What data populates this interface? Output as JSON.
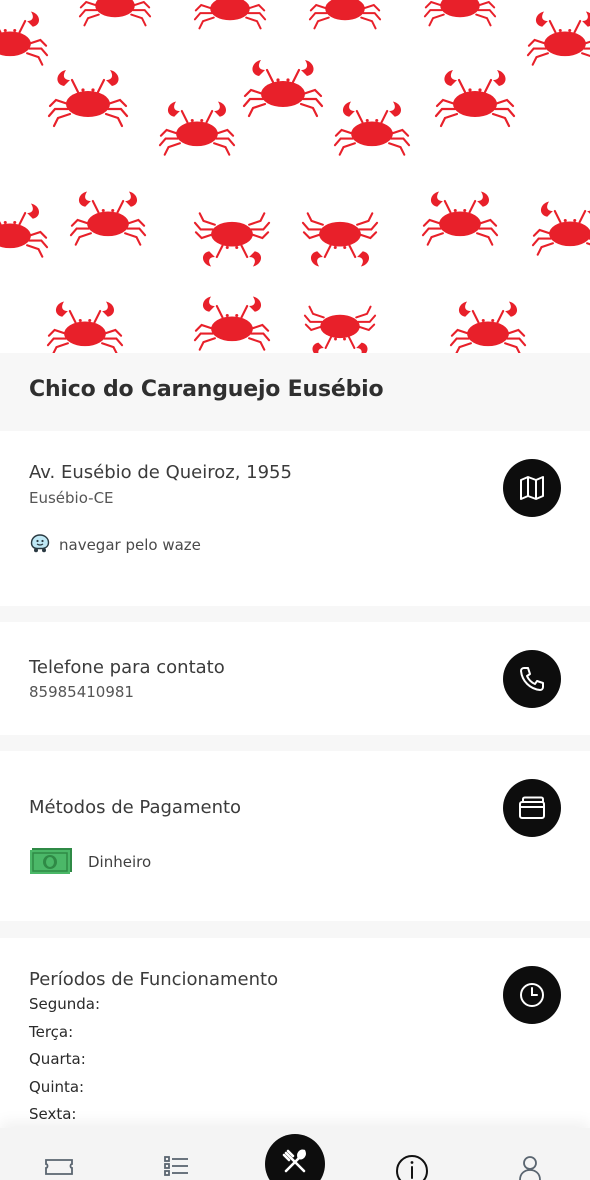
{
  "restaurant": {
    "name": "Chico do Caranguejo Eusébio"
  },
  "address": {
    "street": "Av. Eusébio de Queiroz, 1955",
    "city": "Eusébio-CE",
    "waze_label": "navegar pelo waze",
    "map_icon": "map-icon"
  },
  "contact": {
    "heading": "Telefone para contato",
    "phone": "85985410981",
    "phone_icon": "phone-icon"
  },
  "payment": {
    "heading": "Métodos de Pagamento",
    "methods": [
      {
        "label": "Dinheiro",
        "icon": "cash-icon"
      }
    ],
    "wallet_icon": "wallet-icon"
  },
  "hours": {
    "heading": "Períodos de Funcionamento",
    "days": [
      "Segunda:",
      "Terça:",
      "Quarta:",
      "Quinta:",
      "Sexta:"
    ],
    "clock_icon": "clock-icon"
  },
  "bottom_nav": {
    "items": [
      "ticket-icon",
      "list-icon",
      "cutlery-icon",
      "info-icon",
      "user-icon"
    ],
    "active": "cutlery-icon"
  },
  "colors": {
    "accent_black": "#0d0d0d",
    "crab_red": "#e8202a",
    "cash_green": "#3aa85a"
  }
}
